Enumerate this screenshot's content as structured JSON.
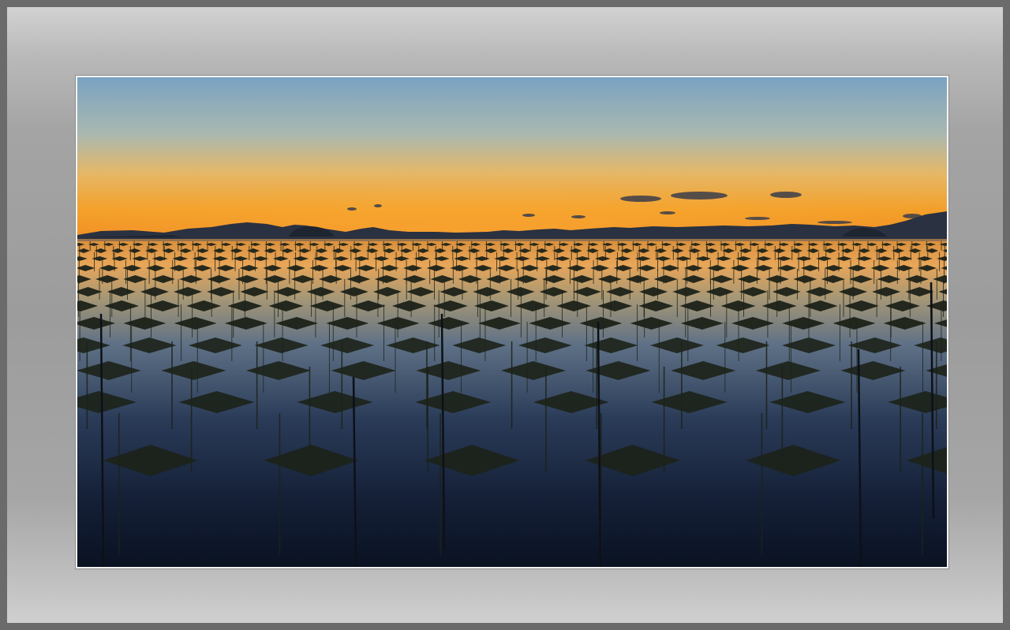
{
  "scene": {
    "subject": "seaweed-farm-at-sunset",
    "colors": {
      "sky_top": "#7fa6c3",
      "sky_mid": "#c8b98a",
      "horizon_glow": "#f29a1a",
      "water_bright": "#e9a24a",
      "water_dark": "#0c1424",
      "silhouette": "#1c2218"
    }
  }
}
